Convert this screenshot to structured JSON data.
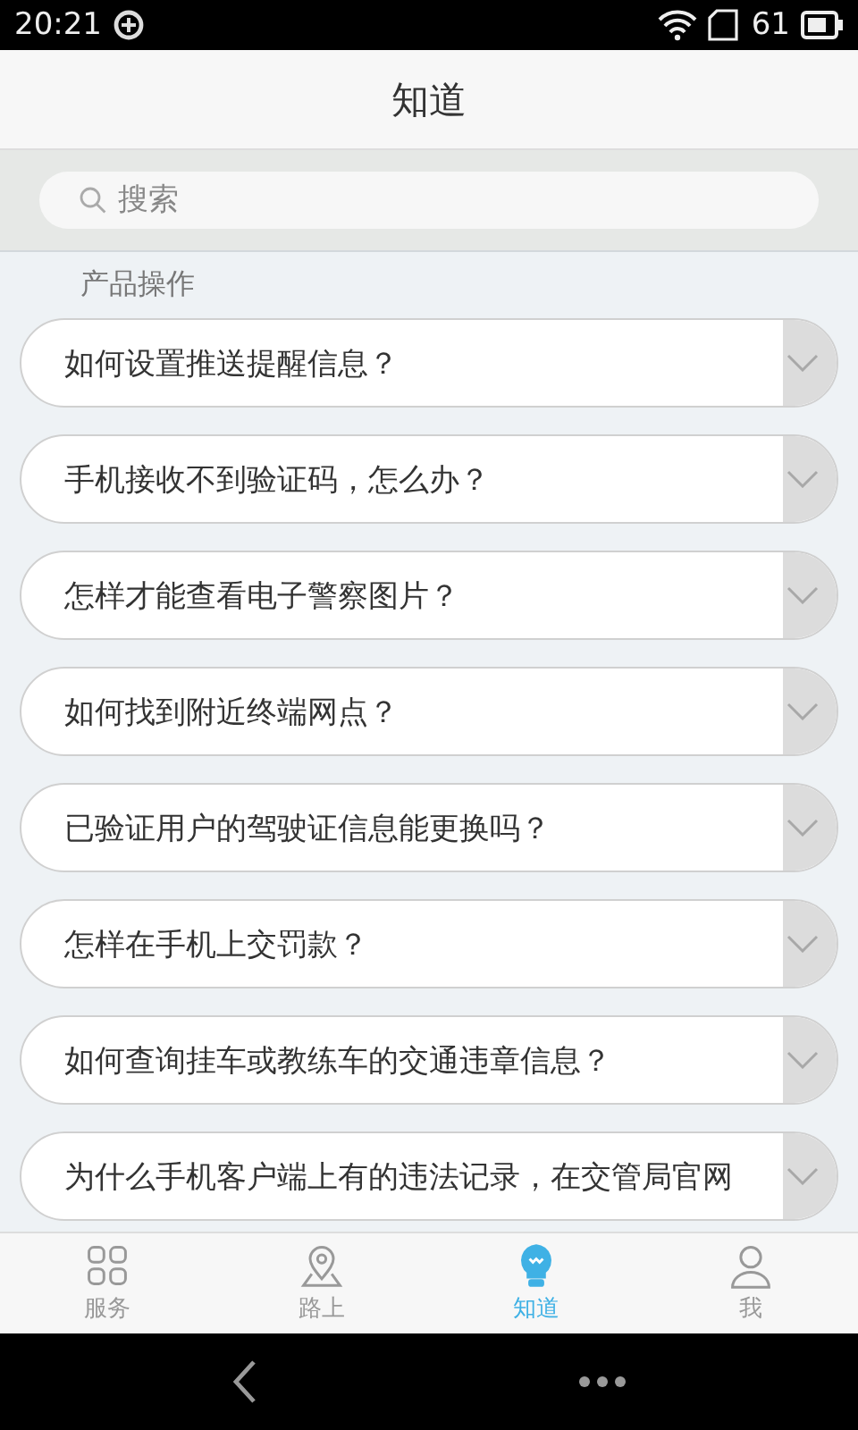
{
  "status_bar": {
    "time": "20:21",
    "battery_text": "61"
  },
  "header": {
    "title": "知道"
  },
  "search": {
    "placeholder": "搜索"
  },
  "section": {
    "title": "产品操作"
  },
  "questions": [
    {
      "text": "如何设置推送提醒信息？",
      "expanded": false
    },
    {
      "text": "手机接收不到验证码，怎么办？",
      "expanded": false
    },
    {
      "text": "怎样才能查看电子警察图片？",
      "expanded": false
    },
    {
      "text": "如何找到附近终端网点？",
      "expanded": false
    },
    {
      "text": "已验证用户的驾驶证信息能更换吗？",
      "expanded": false
    },
    {
      "text": "怎样在手机上交罚款？",
      "expanded": false
    },
    {
      "text": "如何查询挂车或教练车的交通违章信息？",
      "expanded": false
    },
    {
      "text": "为什么手机客户端上有的违法记录，在交管局官网",
      "expanded": false
    }
  ],
  "tabs": [
    {
      "label": "服务",
      "kind": "grid",
      "selected": false
    },
    {
      "label": "路上",
      "kind": "pin",
      "selected": false
    },
    {
      "label": "知道",
      "kind": "bulb",
      "selected": true
    },
    {
      "label": "我",
      "kind": "person",
      "selected": false
    }
  ]
}
